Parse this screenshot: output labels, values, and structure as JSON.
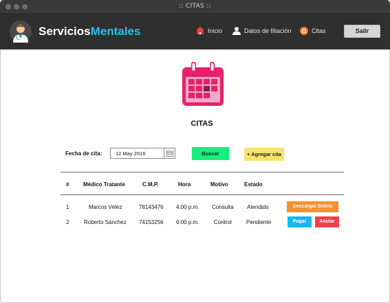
{
  "window": {
    "title": ":: CITAS ::"
  },
  "brand": {
    "word1": "Servicios",
    "word2": "Mentales"
  },
  "nav": {
    "items": [
      {
        "label": "Inicio",
        "icon": "home-icon"
      },
      {
        "label": "Datos de filiación",
        "icon": "user-icon"
      },
      {
        "label": "Citas",
        "icon": "circle-record-icon"
      }
    ],
    "logout_label": "Salir"
  },
  "page": {
    "title": "CITAS"
  },
  "filter": {
    "date_label": "Fecha de cita:",
    "date_value": "12 May 2016",
    "search_label": "Buscar",
    "add_label": "+ Agregar cita"
  },
  "table": {
    "headers": [
      "#",
      "Médico Tratante",
      "C.M.P.",
      "Hora",
      "Motivo",
      "Estado"
    ],
    "rows": [
      {
        "num": "1",
        "doctor": "Marcos Vélez",
        "cmp": "78143476",
        "time": "4:00 p.m.",
        "reason": "Consulta",
        "status": "Atendido",
        "actions": [
          {
            "label": "Descargar Boleta",
            "color": "#f5922e"
          }
        ]
      },
      {
        "num": "2",
        "doctor": "Roberto Sánchez",
        "cmp": "74153256",
        "time": "6:00 p.m.",
        "reason": "Control",
        "status": "Pendiente",
        "actions": [
          {
            "label": "Pagar",
            "color": "#19b6ec"
          },
          {
            "label": "Anular",
            "color": "#f0414b"
          }
        ]
      }
    ]
  },
  "colors": {
    "header_bg": "#2f2f2f",
    "brand_accent": "#23c1ee",
    "calendar_icon": "#e5226b",
    "search_button": "#14f07a",
    "add_button": "#f6e36c"
  }
}
